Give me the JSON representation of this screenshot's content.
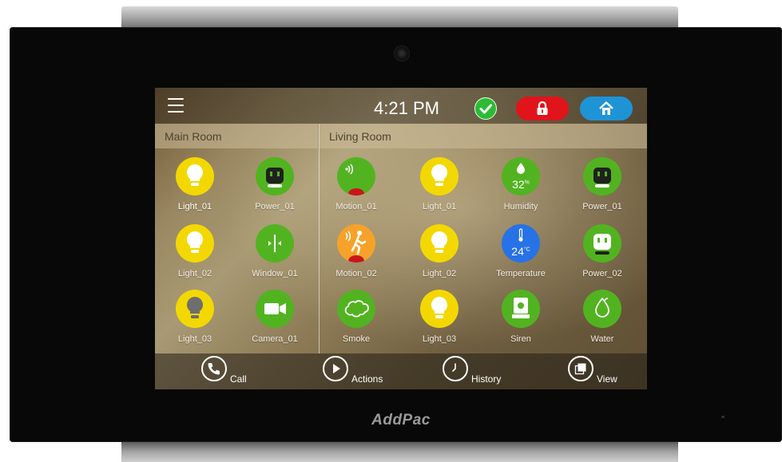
{
  "device": {
    "brand": "AddPac"
  },
  "status_bar": {
    "time": "4:21 PM",
    "icons": [
      "menu-icon",
      "check-icon",
      "lock-icon",
      "home-alarm-icon"
    ],
    "colors": {
      "check": "#2dbb35",
      "lock": "#e0141a",
      "home": "#1e94d6"
    }
  },
  "rooms": [
    {
      "name": "Main Room",
      "devices": [
        {
          "label": "Light_01",
          "icon": "bulb-icon",
          "color": "#f3d800",
          "state": "on"
        },
        {
          "label": "Power_01",
          "icon": "outlet-icon",
          "color": "#52b320"
        },
        {
          "label": "Light_02",
          "icon": "bulb-icon",
          "color": "#f3d800",
          "state": "on"
        },
        {
          "label": "Window_01",
          "icon": "window-icon",
          "color": "#52b320"
        },
        {
          "label": "Light_03",
          "icon": "bulb-icon",
          "color": "#f3d800",
          "state": "off"
        },
        {
          "label": "Camera_01",
          "icon": "camera-icon",
          "color": "#52b320"
        }
      ]
    },
    {
      "name": "Living Room",
      "devices": [
        {
          "label": "Motion_01",
          "icon": "motion-icon",
          "color": "#52b320"
        },
        {
          "label": "Light_01",
          "icon": "bulb-icon",
          "color": "#f3d800",
          "state": "on"
        },
        {
          "label": "Humidity",
          "icon": "humidity-icon",
          "color": "#52b320",
          "value": "32",
          "unit": "%"
        },
        {
          "label": "Power_01",
          "icon": "outlet-icon",
          "color": "#52b320"
        },
        {
          "label": "Motion_02",
          "icon": "walking-person-icon",
          "color": "#f6a22a"
        },
        {
          "label": "Light_02",
          "icon": "bulb-icon",
          "color": "#f3d800",
          "state": "on"
        },
        {
          "label": "Temperature",
          "icon": "thermometer-icon",
          "color": "#2772e6",
          "value": "24",
          "unit": "°C"
        },
        {
          "label": "Power_02",
          "icon": "outlet-icon",
          "color": "#52b320"
        },
        {
          "label": "Smoke",
          "icon": "cloud-icon",
          "color": "#52b320"
        },
        {
          "label": "Light_03",
          "icon": "bulb-icon",
          "color": "#f3d800",
          "state": "on"
        },
        {
          "label": "Siren",
          "icon": "siren-icon",
          "color": "#52b320"
        },
        {
          "label": "Water",
          "icon": "water-drop-icon",
          "color": "#52b320"
        }
      ]
    }
  ],
  "bottom_nav": [
    {
      "label": "Call",
      "icon": "phone-icon"
    },
    {
      "label": "Actions",
      "icon": "play-icon"
    },
    {
      "label": "History",
      "icon": "clock-icon"
    },
    {
      "label": "View",
      "icon": "view-icon"
    }
  ]
}
